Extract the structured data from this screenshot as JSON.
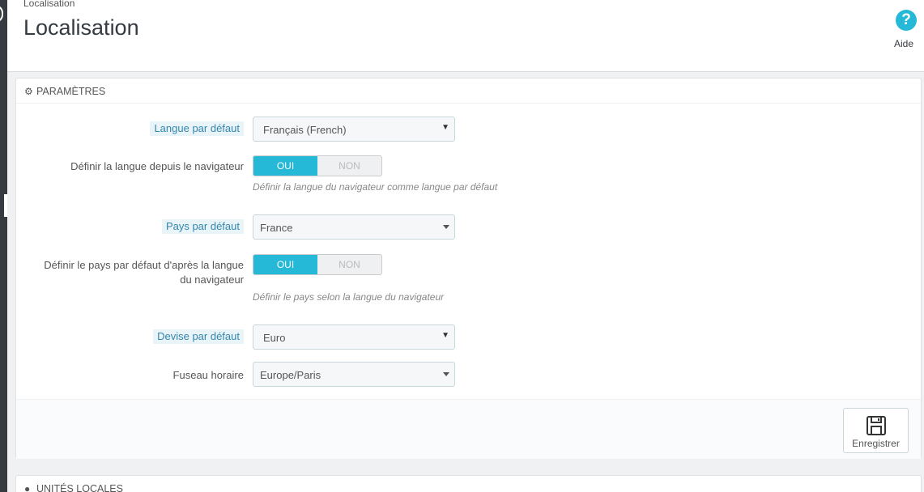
{
  "header": {
    "breadcrumb": "Localisation",
    "title": "Localisation",
    "help_label": "Aide"
  },
  "settings_panel": {
    "heading": "Paramètres",
    "fields": {
      "default_language": {
        "label": "Langue par défaut",
        "value": "Français (French)"
      },
      "browser_language": {
        "label": "Définir la langue depuis le navigateur",
        "on": "OUI",
        "off": "NON",
        "hint": "Définir la langue du navigateur comme langue par défaut"
      },
      "default_country": {
        "label": "Pays par défaut",
        "value": "France"
      },
      "country_from_browser": {
        "label_line1": "Définir le pays par défaut d'après la langue",
        "label_line2": "du navigateur",
        "on": "OUI",
        "off": "NON",
        "hint": "Définir le pays selon la langue du navigateur"
      },
      "default_currency": {
        "label": "Devise par défaut",
        "value": "Euro"
      },
      "timezone": {
        "label": "Fuseau horaire",
        "value": "Europe/Paris"
      }
    },
    "save_label": "Enregistrer"
  },
  "units_panel": {
    "heading": "Unités locales"
  },
  "colors": {
    "accent": "#25b9d7",
    "sidebar": "#363a41",
    "required_label_bg": "#e8f4f8",
    "required_label_text": "#3586ae"
  }
}
